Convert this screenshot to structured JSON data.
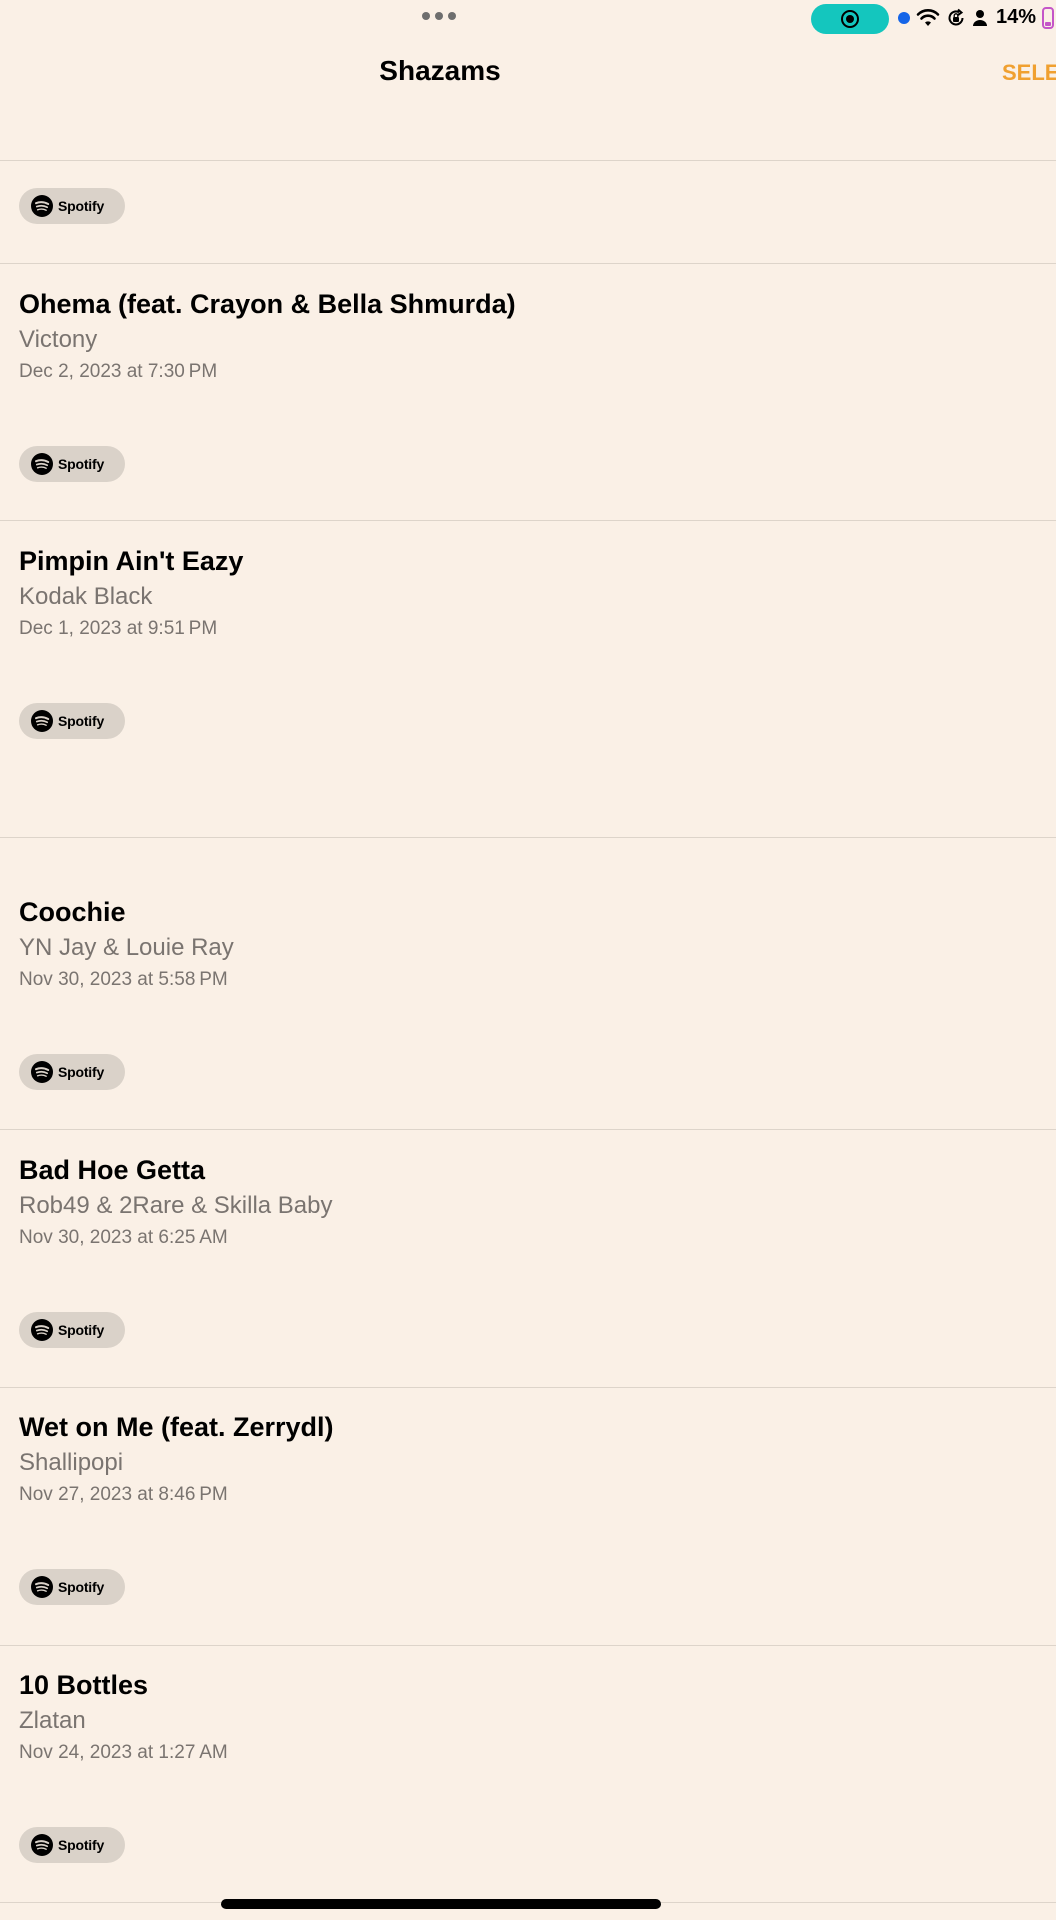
{
  "status_bar": {
    "battery_percent": "14%",
    "record_color": "#14C6BE",
    "icons": [
      "more-dots-icon",
      "screen-record-icon",
      "location-dot-icon",
      "wifi-icon",
      "orientation-lock-icon",
      "person-icon",
      "battery-icon"
    ]
  },
  "header": {
    "title": "Shazams",
    "select_label": "SELE"
  },
  "colors": {
    "background": "#FAF0E6",
    "accent": "#F0A030",
    "badge": "#DAD2C9",
    "secondary_text": "#7A7470"
  },
  "spotify_label": "Spotify",
  "songs": [
    {
      "title": "Ohema (feat. Crayon & Bella Shmurda)",
      "artist": "Victony",
      "date": "Dec 2, 2023 at 7:30 PM"
    },
    {
      "title": "Pimpin Ain't Eazy",
      "artist": "Kodak Black",
      "date": "Dec 1, 2023 at 9:51 PM"
    },
    {
      "title": "Coochie",
      "artist": "YN Jay & Louie Ray",
      "date": "Nov 30, 2023 at 5:58 PM"
    },
    {
      "title": "Bad Hoe Getta",
      "artist": "Rob49 & 2Rare & Skilla Baby",
      "date": "Nov 30, 2023 at 6:25 AM"
    },
    {
      "title": "Wet on Me (feat. Zerrydl)",
      "artist": "Shallipopi",
      "date": "Nov 27, 2023 at 8:46 PM"
    },
    {
      "title": "10 Bottles",
      "artist": "Zlatan",
      "date": "Nov 24, 2023 at 1:27 AM"
    }
  ]
}
